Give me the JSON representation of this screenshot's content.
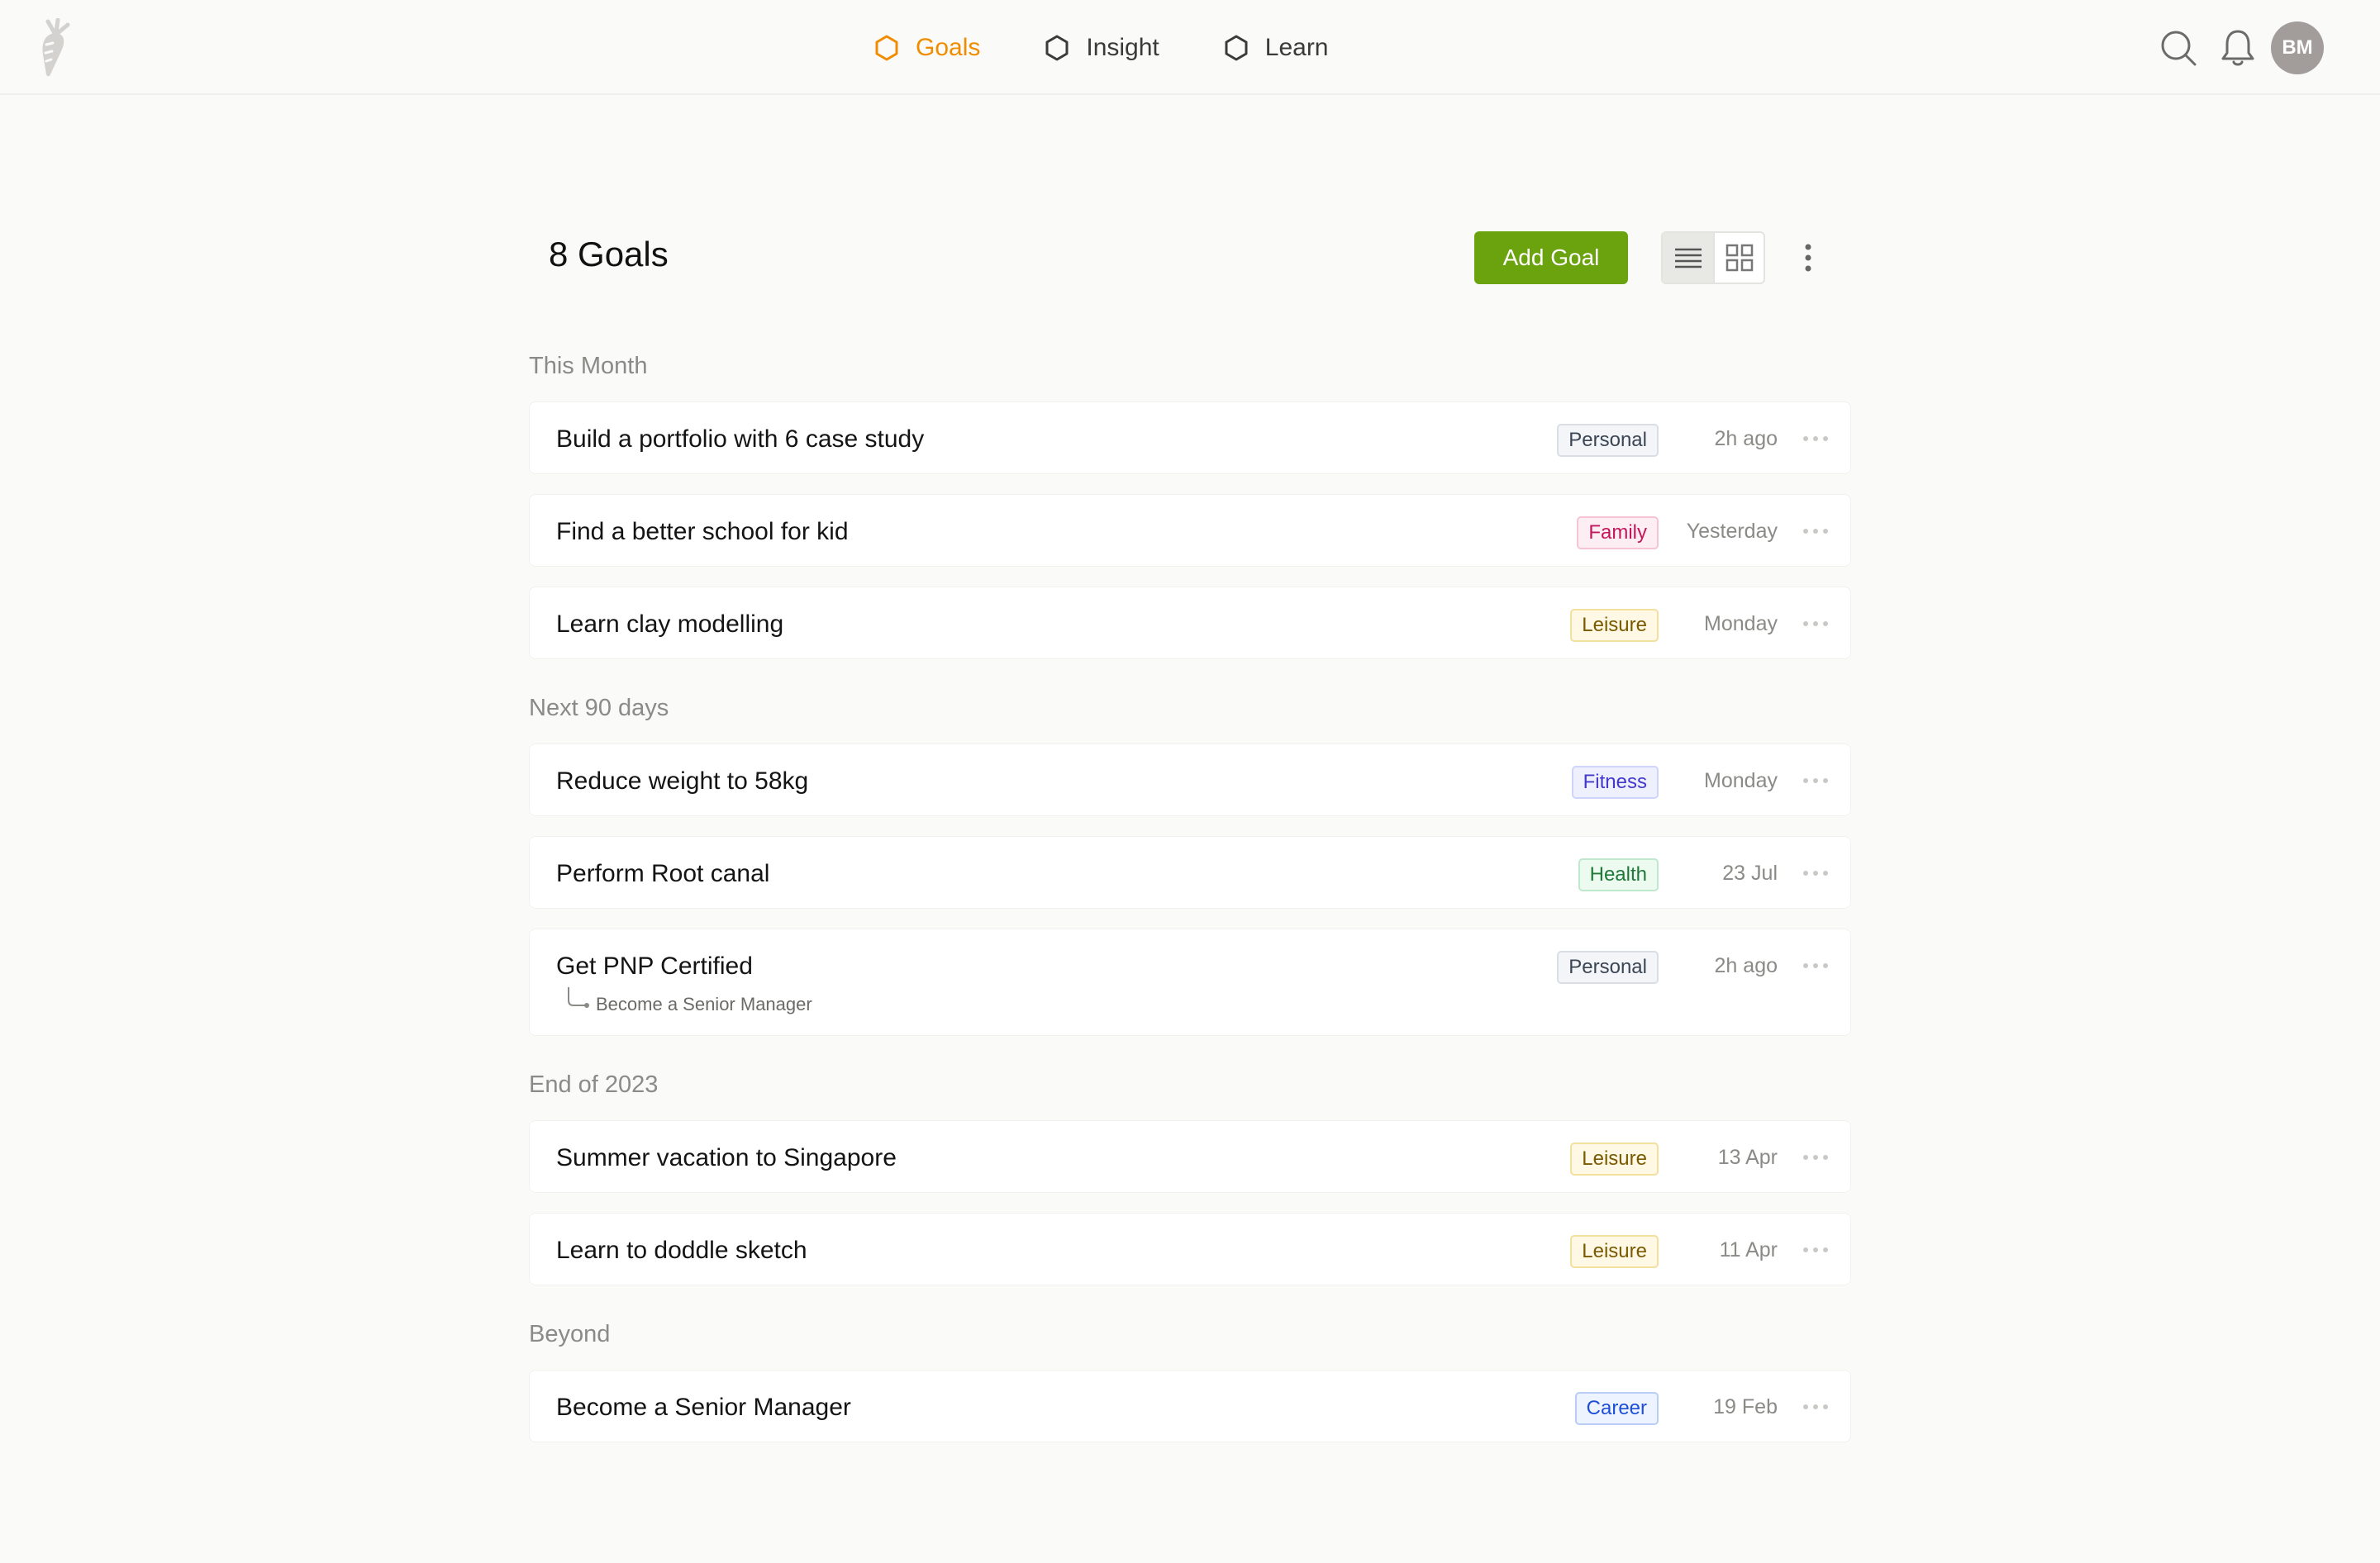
{
  "nav": {
    "items": [
      {
        "label": "Goals",
        "active": true
      },
      {
        "label": "Insight",
        "active": false
      },
      {
        "label": "Learn",
        "active": false
      }
    ]
  },
  "user": {
    "initials": "BM"
  },
  "header": {
    "title": "8 Goals",
    "add_label": "Add Goal"
  },
  "colors": {
    "accent": "#f08c00",
    "primary_button": "#6aa30e"
  },
  "sections": [
    {
      "title": "This Month",
      "goals": [
        {
          "title": "Build a portfolio with 6 case study",
          "tag": "Personal",
          "tag_style": "personal",
          "time": "2h ago"
        },
        {
          "title": "Find a better school for kid",
          "tag": "Family",
          "tag_style": "family",
          "time": "Yesterday"
        },
        {
          "title": "Learn clay modelling",
          "tag": "Leisure",
          "tag_style": "leisure",
          "time": "Monday"
        }
      ]
    },
    {
      "title": "Next 90 days",
      "goals": [
        {
          "title": "Reduce weight to 58kg",
          "tag": "Fitness",
          "tag_style": "fitness",
          "time": "Monday"
        },
        {
          "title": "Perform Root canal",
          "tag": "Health",
          "tag_style": "health",
          "time": "23 Jul"
        },
        {
          "title": "Get PNP Certified",
          "tag": "Personal",
          "tag_style": "personal",
          "time": "2h ago",
          "parent": "Become a Senior Manager"
        }
      ]
    },
    {
      "title": "End of 2023",
      "goals": [
        {
          "title": "Summer vacation to Singapore",
          "tag": "Leisure",
          "tag_style": "leisure",
          "time": "13 Apr"
        },
        {
          "title": "Learn to doddle sketch",
          "tag": "Leisure",
          "tag_style": "leisure",
          "time": "11 Apr"
        }
      ]
    },
    {
      "title": "Beyond",
      "goals": [
        {
          "title": "Become a Senior Manager",
          "tag": "Career",
          "tag_style": "career",
          "time": "19 Feb"
        }
      ]
    }
  ]
}
